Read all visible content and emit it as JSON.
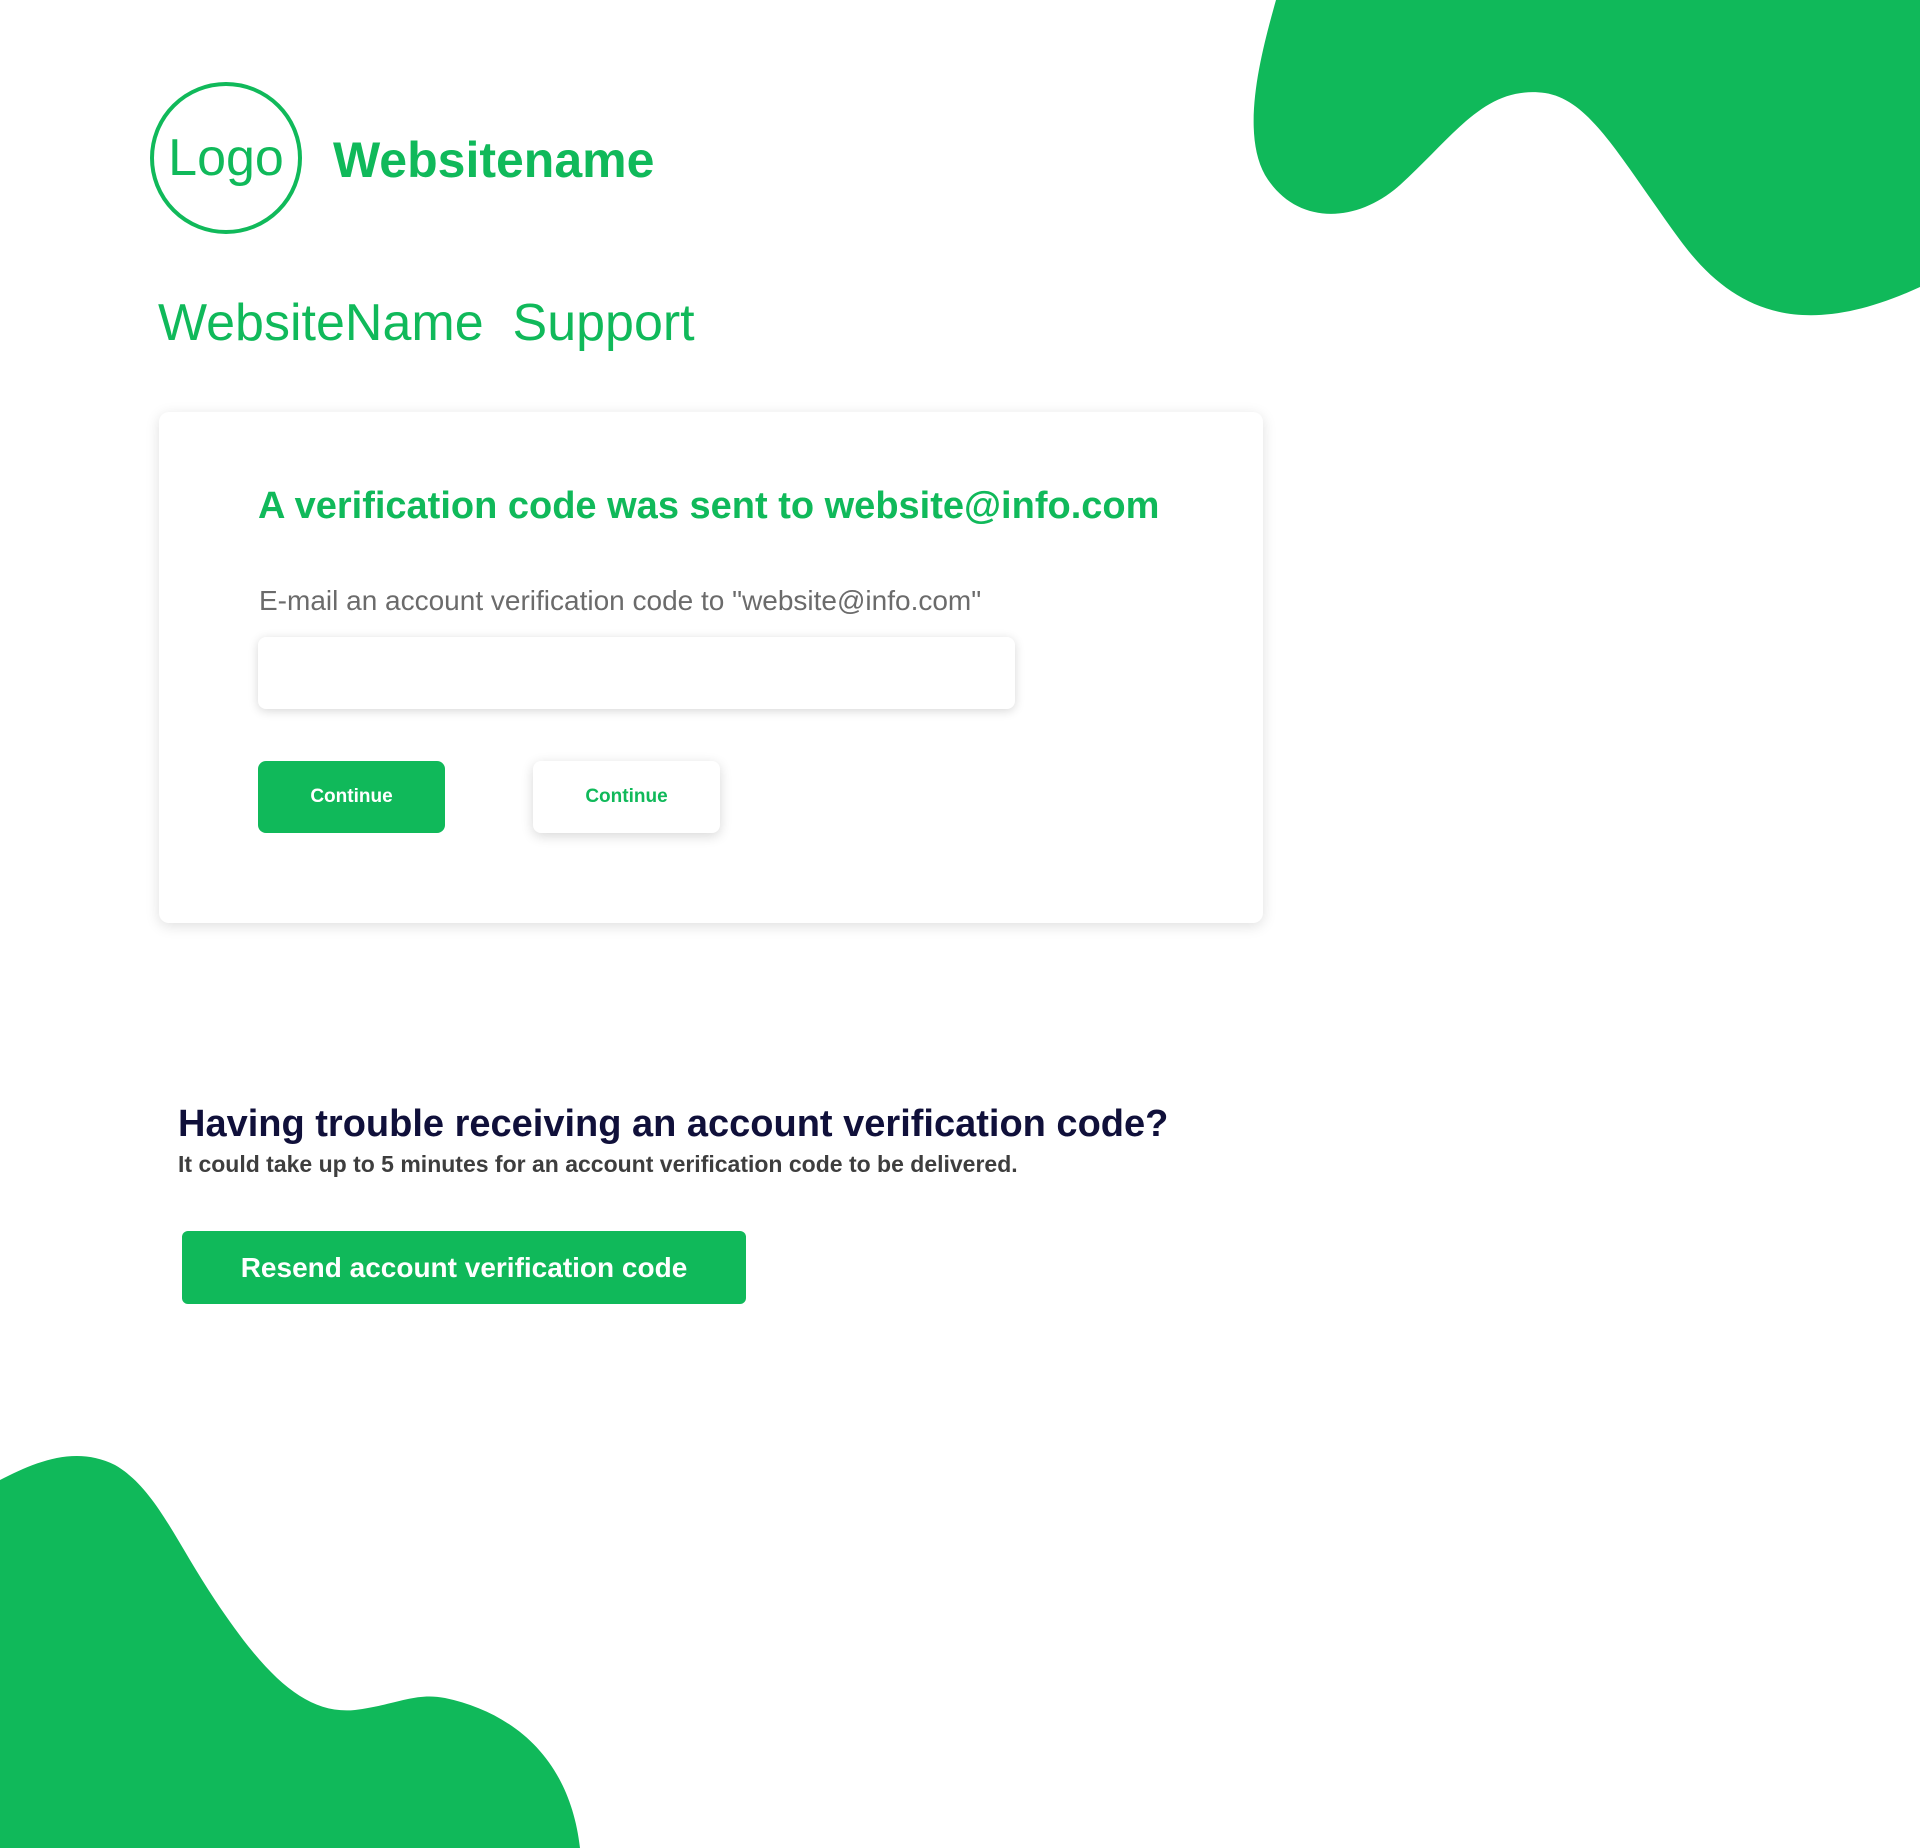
{
  "colors": {
    "brand_green": "#10b95a",
    "heading_dark": "#10103a",
    "body_text": "#3e3e3e",
    "label_gray": "#6b6b6b",
    "background": "#ffffff"
  },
  "header": {
    "logo_text": "Logo",
    "site_name": "Websitename",
    "support_title": "WebsiteName  Support"
  },
  "verification_card": {
    "heading": "A verification code was sent to website@info.com",
    "field_label": "E-mail an account verification code to \"website@info.com\"",
    "code_value": "",
    "code_placeholder": "",
    "primary_button_label": "Continue",
    "secondary_button_label": "Continue"
  },
  "trouble_section": {
    "heading": "Having trouble receiving an account verification code?",
    "description": "It could take up to 5 minutes for an account verification code to be delivered.",
    "resend_button_label": "Resend account verification code"
  }
}
